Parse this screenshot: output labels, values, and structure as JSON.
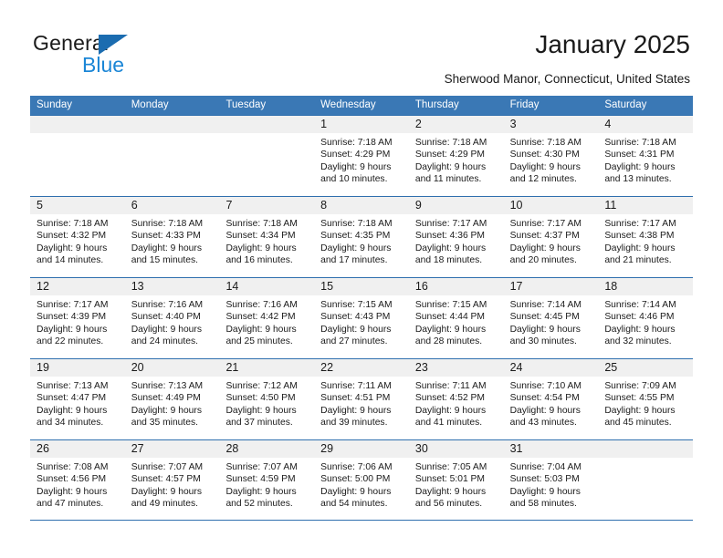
{
  "brand": {
    "name_top": "General",
    "name_bottom": "Blue",
    "triangle_icon": "blue-triangle-icon",
    "accent_color": "#1b6cb0",
    "accent_color_light": "#1b86d6"
  },
  "header": {
    "title": "January 2025",
    "subtitle": "Sherwood Manor, Connecticut, United States"
  },
  "calendar": {
    "header_bg_color": "#3a78b5",
    "row_border_color": "#2f6fae",
    "day_band_color": "#f0f0f0",
    "weekdays": [
      "Sunday",
      "Monday",
      "Tuesday",
      "Wednesday",
      "Thursday",
      "Friday",
      "Saturday"
    ],
    "weeks": [
      [
        {
          "day": "",
          "sunrise": "",
          "sunset": "",
          "daylight_line1": "",
          "daylight_line2": ""
        },
        {
          "day": "",
          "sunrise": "",
          "sunset": "",
          "daylight_line1": "",
          "daylight_line2": ""
        },
        {
          "day": "",
          "sunrise": "",
          "sunset": "",
          "daylight_line1": "",
          "daylight_line2": ""
        },
        {
          "day": "1",
          "sunrise": "Sunrise: 7:18 AM",
          "sunset": "Sunset: 4:29 PM",
          "daylight_line1": "Daylight: 9 hours",
          "daylight_line2": "and 10 minutes."
        },
        {
          "day": "2",
          "sunrise": "Sunrise: 7:18 AM",
          "sunset": "Sunset: 4:29 PM",
          "daylight_line1": "Daylight: 9 hours",
          "daylight_line2": "and 11 minutes."
        },
        {
          "day": "3",
          "sunrise": "Sunrise: 7:18 AM",
          "sunset": "Sunset: 4:30 PM",
          "daylight_line1": "Daylight: 9 hours",
          "daylight_line2": "and 12 minutes."
        },
        {
          "day": "4",
          "sunrise": "Sunrise: 7:18 AM",
          "sunset": "Sunset: 4:31 PM",
          "daylight_line1": "Daylight: 9 hours",
          "daylight_line2": "and 13 minutes."
        }
      ],
      [
        {
          "day": "5",
          "sunrise": "Sunrise: 7:18 AM",
          "sunset": "Sunset: 4:32 PM",
          "daylight_line1": "Daylight: 9 hours",
          "daylight_line2": "and 14 minutes."
        },
        {
          "day": "6",
          "sunrise": "Sunrise: 7:18 AM",
          "sunset": "Sunset: 4:33 PM",
          "daylight_line1": "Daylight: 9 hours",
          "daylight_line2": "and 15 minutes."
        },
        {
          "day": "7",
          "sunrise": "Sunrise: 7:18 AM",
          "sunset": "Sunset: 4:34 PM",
          "daylight_line1": "Daylight: 9 hours",
          "daylight_line2": "and 16 minutes."
        },
        {
          "day": "8",
          "sunrise": "Sunrise: 7:18 AM",
          "sunset": "Sunset: 4:35 PM",
          "daylight_line1": "Daylight: 9 hours",
          "daylight_line2": "and 17 minutes."
        },
        {
          "day": "9",
          "sunrise": "Sunrise: 7:17 AM",
          "sunset": "Sunset: 4:36 PM",
          "daylight_line1": "Daylight: 9 hours",
          "daylight_line2": "and 18 minutes."
        },
        {
          "day": "10",
          "sunrise": "Sunrise: 7:17 AM",
          "sunset": "Sunset: 4:37 PM",
          "daylight_line1": "Daylight: 9 hours",
          "daylight_line2": "and 20 minutes."
        },
        {
          "day": "11",
          "sunrise": "Sunrise: 7:17 AM",
          "sunset": "Sunset: 4:38 PM",
          "daylight_line1": "Daylight: 9 hours",
          "daylight_line2": "and 21 minutes."
        }
      ],
      [
        {
          "day": "12",
          "sunrise": "Sunrise: 7:17 AM",
          "sunset": "Sunset: 4:39 PM",
          "daylight_line1": "Daylight: 9 hours",
          "daylight_line2": "and 22 minutes."
        },
        {
          "day": "13",
          "sunrise": "Sunrise: 7:16 AM",
          "sunset": "Sunset: 4:40 PM",
          "daylight_line1": "Daylight: 9 hours",
          "daylight_line2": "and 24 minutes."
        },
        {
          "day": "14",
          "sunrise": "Sunrise: 7:16 AM",
          "sunset": "Sunset: 4:42 PM",
          "daylight_line1": "Daylight: 9 hours",
          "daylight_line2": "and 25 minutes."
        },
        {
          "day": "15",
          "sunrise": "Sunrise: 7:15 AM",
          "sunset": "Sunset: 4:43 PM",
          "daylight_line1": "Daylight: 9 hours",
          "daylight_line2": "and 27 minutes."
        },
        {
          "day": "16",
          "sunrise": "Sunrise: 7:15 AM",
          "sunset": "Sunset: 4:44 PM",
          "daylight_line1": "Daylight: 9 hours",
          "daylight_line2": "and 28 minutes."
        },
        {
          "day": "17",
          "sunrise": "Sunrise: 7:14 AM",
          "sunset": "Sunset: 4:45 PM",
          "daylight_line1": "Daylight: 9 hours",
          "daylight_line2": "and 30 minutes."
        },
        {
          "day": "18",
          "sunrise": "Sunrise: 7:14 AM",
          "sunset": "Sunset: 4:46 PM",
          "daylight_line1": "Daylight: 9 hours",
          "daylight_line2": "and 32 minutes."
        }
      ],
      [
        {
          "day": "19",
          "sunrise": "Sunrise: 7:13 AM",
          "sunset": "Sunset: 4:47 PM",
          "daylight_line1": "Daylight: 9 hours",
          "daylight_line2": "and 34 minutes."
        },
        {
          "day": "20",
          "sunrise": "Sunrise: 7:13 AM",
          "sunset": "Sunset: 4:49 PM",
          "daylight_line1": "Daylight: 9 hours",
          "daylight_line2": "and 35 minutes."
        },
        {
          "day": "21",
          "sunrise": "Sunrise: 7:12 AM",
          "sunset": "Sunset: 4:50 PM",
          "daylight_line1": "Daylight: 9 hours",
          "daylight_line2": "and 37 minutes."
        },
        {
          "day": "22",
          "sunrise": "Sunrise: 7:11 AM",
          "sunset": "Sunset: 4:51 PM",
          "daylight_line1": "Daylight: 9 hours",
          "daylight_line2": "and 39 minutes."
        },
        {
          "day": "23",
          "sunrise": "Sunrise: 7:11 AM",
          "sunset": "Sunset: 4:52 PM",
          "daylight_line1": "Daylight: 9 hours",
          "daylight_line2": "and 41 minutes."
        },
        {
          "day": "24",
          "sunrise": "Sunrise: 7:10 AM",
          "sunset": "Sunset: 4:54 PM",
          "daylight_line1": "Daylight: 9 hours",
          "daylight_line2": "and 43 minutes."
        },
        {
          "day": "25",
          "sunrise": "Sunrise: 7:09 AM",
          "sunset": "Sunset: 4:55 PM",
          "daylight_line1": "Daylight: 9 hours",
          "daylight_line2": "and 45 minutes."
        }
      ],
      [
        {
          "day": "26",
          "sunrise": "Sunrise: 7:08 AM",
          "sunset": "Sunset: 4:56 PM",
          "daylight_line1": "Daylight: 9 hours",
          "daylight_line2": "and 47 minutes."
        },
        {
          "day": "27",
          "sunrise": "Sunrise: 7:07 AM",
          "sunset": "Sunset: 4:57 PM",
          "daylight_line1": "Daylight: 9 hours",
          "daylight_line2": "and 49 minutes."
        },
        {
          "day": "28",
          "sunrise": "Sunrise: 7:07 AM",
          "sunset": "Sunset: 4:59 PM",
          "daylight_line1": "Daylight: 9 hours",
          "daylight_line2": "and 52 minutes."
        },
        {
          "day": "29",
          "sunrise": "Sunrise: 7:06 AM",
          "sunset": "Sunset: 5:00 PM",
          "daylight_line1": "Daylight: 9 hours",
          "daylight_line2": "and 54 minutes."
        },
        {
          "day": "30",
          "sunrise": "Sunrise: 7:05 AM",
          "sunset": "Sunset: 5:01 PM",
          "daylight_line1": "Daylight: 9 hours",
          "daylight_line2": "and 56 minutes."
        },
        {
          "day": "31",
          "sunrise": "Sunrise: 7:04 AM",
          "sunset": "Sunset: 5:03 PM",
          "daylight_line1": "Daylight: 9 hours",
          "daylight_line2": "and 58 minutes."
        },
        {
          "day": "",
          "sunrise": "",
          "sunset": "",
          "daylight_line1": "",
          "daylight_line2": ""
        }
      ]
    ]
  }
}
